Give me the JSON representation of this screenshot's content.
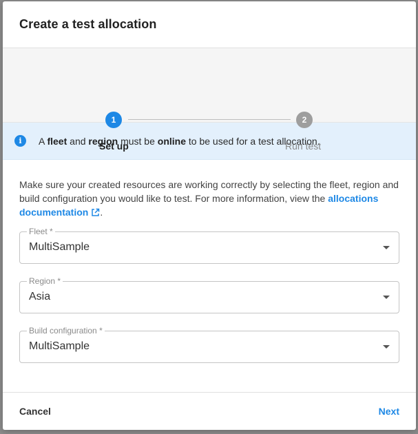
{
  "dialog": {
    "title": "Create a test allocation"
  },
  "stepper": {
    "steps": [
      {
        "number": "1",
        "label": "Set up",
        "active": true
      },
      {
        "number": "2",
        "label": "Run test",
        "active": false
      }
    ]
  },
  "info_banner": {
    "icon": "info-icon",
    "icon_glyph": "i",
    "parts": [
      "A ",
      "fleet",
      " and ",
      "region",
      " must be ",
      "online",
      " to be used for a test allocation."
    ]
  },
  "description": {
    "text": "Make sure your created resources are working correctly by selecting the fleet, region and build configuration you would like to test. For more information, view the ",
    "link_text": "allocations documentation",
    "suffix": "."
  },
  "fields": [
    {
      "label": "Fleet *",
      "value": "MultiSample"
    },
    {
      "label": "Region *",
      "value": "Asia"
    },
    {
      "label": "Build configuration *",
      "value": "MultiSample"
    }
  ],
  "footer": {
    "cancel_label": "Cancel",
    "next_label": "Next"
  },
  "colors": {
    "accent": "#1e88e5",
    "step_inactive": "#9e9e9e",
    "banner_bg": "#e3f0fc"
  }
}
